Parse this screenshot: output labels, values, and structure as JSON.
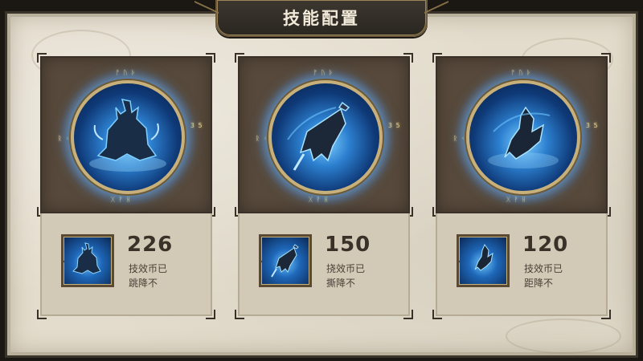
{
  "header": {
    "title": "技能配置"
  },
  "cards": [
    {
      "count": "226",
      "desc_line1": "技效币已",
      "desc_line2": "跳降不",
      "icon": "shadow-figure-icon"
    },
    {
      "count": "150",
      "desc_line1": "挠效币已",
      "desc_line2": "撕降不",
      "icon": "banner-flag-icon"
    },
    {
      "count": "120",
      "desc_line1": "技效币已",
      "desc_line2": "距降不",
      "icon": "shard-crystal-icon"
    }
  ],
  "colors": {
    "parchment": "#e3dccc",
    "card_dark": "#57493b",
    "glow_blue": "#2c7fcf",
    "gold_rim": "#c8b07a"
  }
}
